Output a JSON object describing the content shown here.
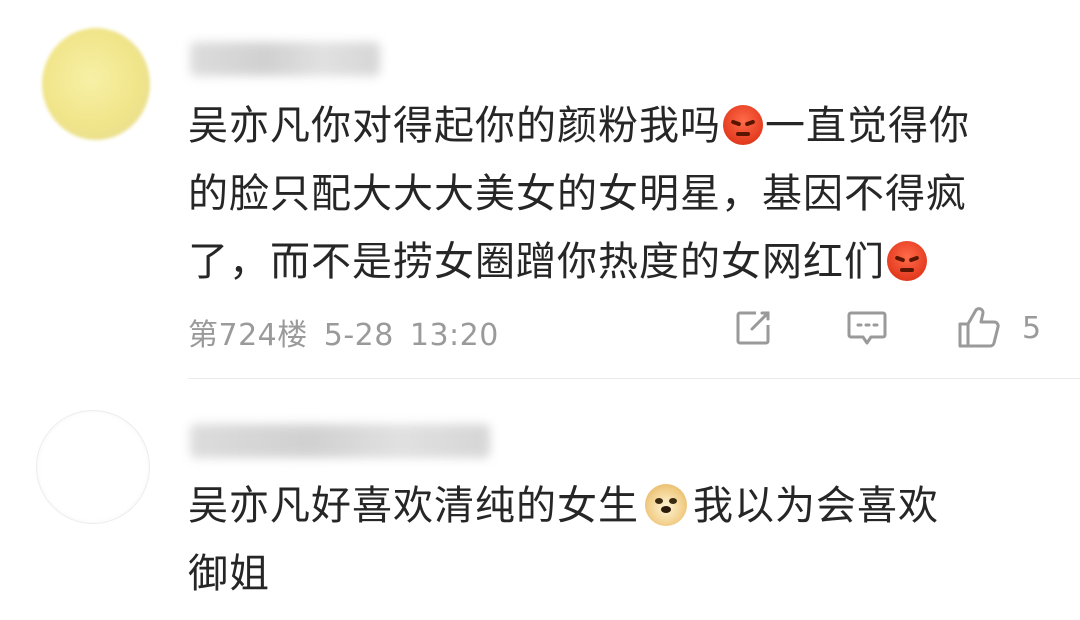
{
  "comments": [
    {
      "lines": [
        "吴亦凡你对得起你的颜粉我吗",
        "一直觉得你",
        "的脸只配大大大美女的女明星，基因不得疯",
        "了，而不是捞女圈蹭你热度的女网红们"
      ],
      "floor": "第724楼",
      "date": "5-28",
      "time": "13:20",
      "like_count": "5",
      "emoji": "angry-face-icon"
    },
    {
      "lines": [
        "吴亦凡好喜欢清纯的女生",
        "我以为会喜欢",
        "御姐"
      ],
      "emoji": "doge-icon"
    }
  ]
}
